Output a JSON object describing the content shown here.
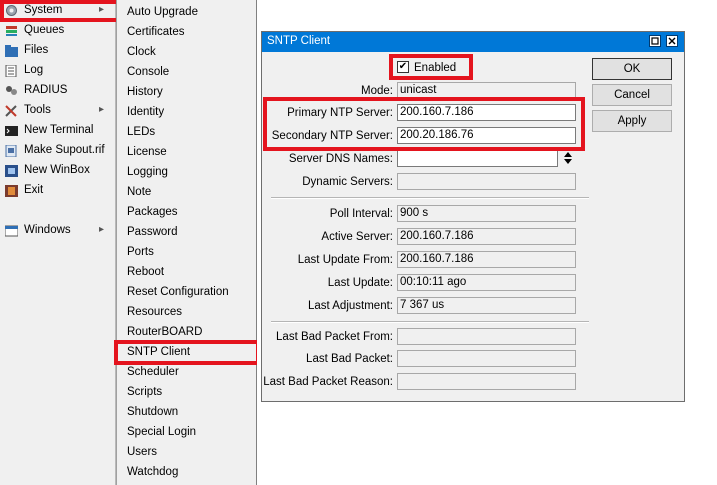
{
  "main_menu": {
    "items": [
      {
        "label": "System",
        "icon": "gear-icon",
        "arrow": true,
        "arrow_glyph": "▸"
      },
      {
        "label": "Queues",
        "icon": "queues-icon",
        "arrow": false
      },
      {
        "label": "Files",
        "icon": "folder-icon",
        "arrow": false
      },
      {
        "label": "Log",
        "icon": "log-icon",
        "arrow": false
      },
      {
        "label": "RADIUS",
        "icon": "radius-icon",
        "arrow": false
      },
      {
        "label": "Tools",
        "icon": "tools-icon",
        "arrow": true,
        "arrow_glyph": "▸"
      },
      {
        "label": "New Terminal",
        "icon": "terminal-icon",
        "arrow": false
      },
      {
        "label": "Make Supout.rif",
        "icon": "supout-icon",
        "arrow": false
      },
      {
        "label": "New WinBox",
        "icon": "winbox-icon",
        "arrow": false
      },
      {
        "label": "Exit",
        "icon": "exit-icon",
        "arrow": false
      },
      {
        "label": "Windows",
        "icon": "windows-icon",
        "arrow": true,
        "arrow_glyph": "▸"
      }
    ]
  },
  "submenu": {
    "items": [
      "Auto Upgrade",
      "Certificates",
      "Clock",
      "Console",
      "History",
      "Identity",
      "LEDs",
      "License",
      "Logging",
      "Note",
      "Packages",
      "Password",
      "Ports",
      "Reboot",
      "Reset Configuration",
      "Resources",
      "RouterBOARD",
      "SNTP Client",
      "Scheduler",
      "Scripts",
      "Shutdown",
      "Special Login",
      "Users",
      "Watchdog"
    ]
  },
  "dialog": {
    "title": "SNTP Client",
    "enabled_label": "Enabled",
    "enabled_check": "✔",
    "mode_label": "Mode:",
    "mode_value": "unicast",
    "primary_label": "Primary NTP Server:",
    "primary_value": "200.160.7.186",
    "secondary_label": "Secondary NTP Server:",
    "secondary_value": "200.20.186.76",
    "dns_label": "Server DNS Names:",
    "dns_value": "",
    "dns_spinner": "⬍",
    "dynamic_label": "Dynamic Servers:",
    "dynamic_value": "",
    "poll_label": "Poll Interval:",
    "poll_value": "900 s",
    "active_label": "Active Server:",
    "active_value": "200.160.7.186",
    "update_from_label": "Last Update From:",
    "update_from_value": "200.160.7.186",
    "last_update_label": "Last Update:",
    "last_update_value": "00:10:11 ago",
    "adjustment_label": "Last Adjustment:",
    "adjustment_value": "7 367 us",
    "bad_from_label": "Last Bad Packet From:",
    "bad_from_value": "",
    "bad_packet_label": "Last Bad Packet:",
    "bad_packet_value": "",
    "bad_reason_label": "Last Bad Packet Reason:",
    "bad_reason_value": "",
    "ok_label": "OK",
    "cancel_label": "Cancel",
    "apply_label": "Apply"
  },
  "colors": {
    "titlebar": "#0078d7",
    "highlight": "#e4141e",
    "menu_bg": "#f0f0f0"
  }
}
